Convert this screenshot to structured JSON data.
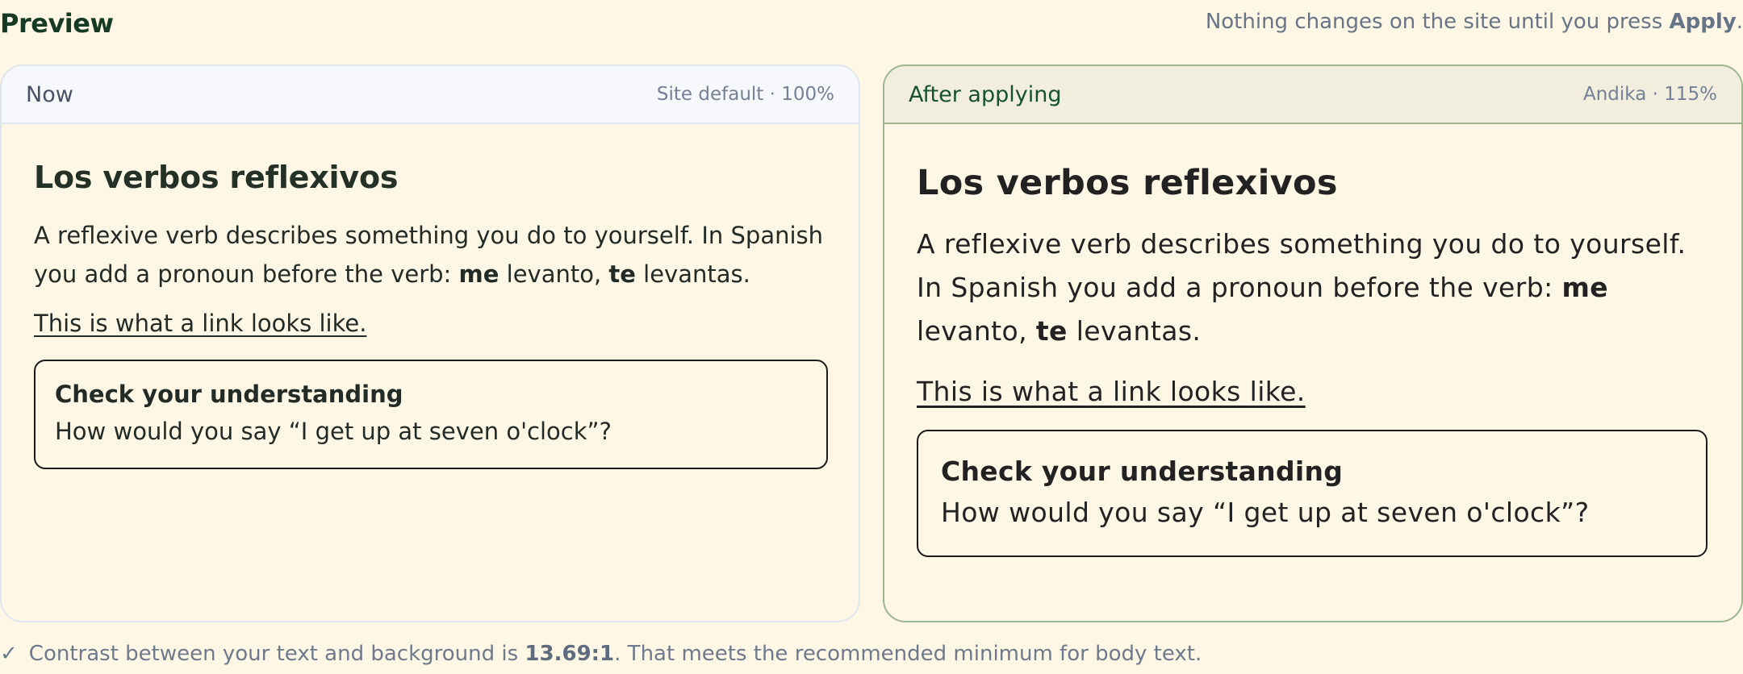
{
  "header": {
    "title": "Preview",
    "note_before": "Nothing changes on the site until you press ",
    "note_action": "Apply",
    "note_after": "."
  },
  "panels": {
    "now": {
      "label": "Now",
      "meta": "Site default · 100%"
    },
    "after": {
      "label": "After applying",
      "meta": "Andika · 115%"
    }
  },
  "sample": {
    "heading": "Los verbos reflexivos",
    "paragraph_part1": "A reflexive verb describes something you do to yourself. In Spanish you add a pronoun before the verb: ",
    "word1": "me",
    "paragraph_part2": " levanto, ",
    "word2": "te",
    "paragraph_part3": " levantas.",
    "link_text": "This is what a link looks like.",
    "card_title": "Check your understanding",
    "card_question": "How would you say “I get up at seven o'clock”?"
  },
  "contrast": {
    "icon": "check-icon",
    "text_before": "Contrast between your text and background is ",
    "ratio": "13.69:1",
    "text_after": ". That meets the recommended minimum for body text."
  }
}
